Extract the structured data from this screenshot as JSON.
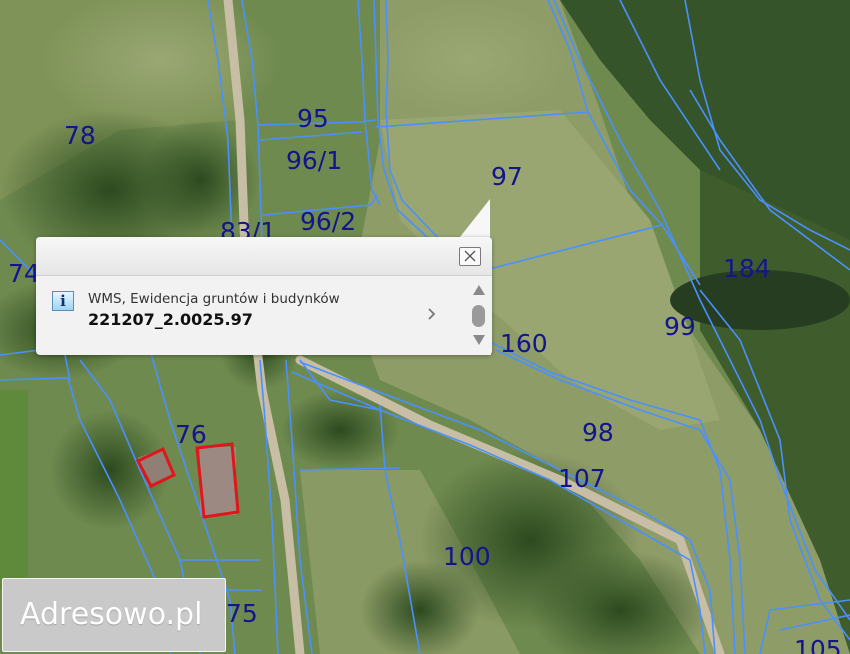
{
  "map": {
    "parcel_labels": [
      "78",
      "74",
      "95",
      "96/1",
      "96/2",
      "83/1",
      "97",
      "184",
      "99",
      "160",
      "76",
      "98",
      "107",
      "100",
      "75",
      "105"
    ]
  },
  "popup": {
    "info_icon_glyph": "i",
    "layer_name": "WMS, Ewidencja gruntów i budynków",
    "parcel_id": "221207_2.0025.97"
  },
  "brand": {
    "text": "Adresowo.pl"
  },
  "colors": {
    "parcel_border": "#4a90ff",
    "parcel_label": "#14148c",
    "building_outline": "#e0161a"
  }
}
